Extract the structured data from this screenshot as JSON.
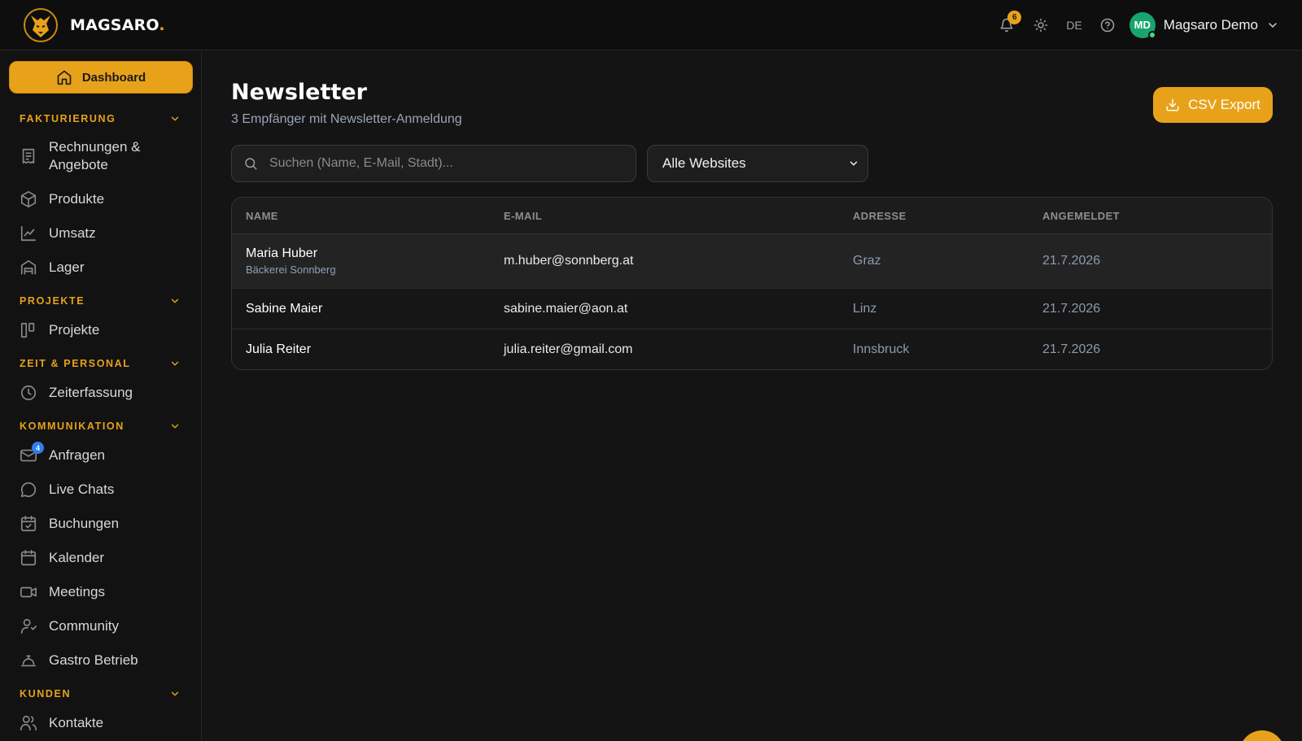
{
  "brand": {
    "name": "MAGSARO",
    "dot": "."
  },
  "header": {
    "notification_count": "6",
    "language": "DE",
    "user_initials": "MD",
    "user_name": "Magsaro Demo"
  },
  "sidebar": {
    "dashboard_label": "Dashboard",
    "sections": [
      {
        "title": "FAKTURIERUNG",
        "items": [
          {
            "label": "Rechnungen &",
            "label2": "Angebote",
            "icon": "receipt-icon"
          },
          {
            "label": "Produkte",
            "icon": "box-icon"
          },
          {
            "label": "Umsatz",
            "icon": "chart-line-icon"
          },
          {
            "label": "Lager",
            "icon": "warehouse-icon"
          }
        ]
      },
      {
        "title": "PROJEKTE",
        "items": [
          {
            "label": "Projekte",
            "icon": "kanban-icon"
          }
        ]
      },
      {
        "title": "ZEIT & PERSONAL",
        "items": [
          {
            "label": "Zeiterfassung",
            "icon": "clock-icon"
          }
        ]
      },
      {
        "title": "KOMMUNIKATION",
        "items": [
          {
            "label": "Anfragen",
            "icon": "mail-icon",
            "badge": "4"
          },
          {
            "label": "Live Chats",
            "icon": "chat-icon"
          },
          {
            "label": "Buchungen",
            "icon": "calendar-check-icon"
          },
          {
            "label": "Kalender",
            "icon": "calendar-icon"
          },
          {
            "label": "Meetings",
            "icon": "video-icon"
          },
          {
            "label": "Community",
            "icon": "users-icon"
          },
          {
            "label": "Gastro Betrieb",
            "icon": "cloche-icon"
          }
        ]
      },
      {
        "title": "KUNDEN",
        "items": [
          {
            "label": "Kontakte",
            "icon": "contacts-icon"
          }
        ]
      }
    ]
  },
  "main": {
    "title": "Newsletter",
    "subtitle": "3 Empfänger mit Newsletter-Anmeldung",
    "csv_export_label": "CSV Export",
    "search_placeholder": "Suchen (Name, E-Mail, Stadt)...",
    "website_filter": {
      "selected": "Alle Websites"
    },
    "table": {
      "headers": [
        "NAME",
        "E-MAIL",
        "ADRESSE",
        "ANGEMELDET"
      ],
      "rows": [
        {
          "name": "Maria Huber",
          "company": "Bäckerei Sonnberg",
          "email": "m.huber@sonnberg.at",
          "address": "Graz",
          "date": "21.7.2026"
        },
        {
          "name": "Sabine Maier",
          "company": "",
          "email": "sabine.maier@aon.at",
          "address": "Linz",
          "date": "21.7.2026"
        },
        {
          "name": "Julia Reiter",
          "company": "",
          "email": "julia.reiter@gmail.com",
          "address": "Innsbruck",
          "date": "21.7.2026"
        }
      ]
    }
  },
  "colors": {
    "accent": "#e8a21a",
    "avatar": "#19a46f",
    "badge_blue": "#2f7df0"
  }
}
